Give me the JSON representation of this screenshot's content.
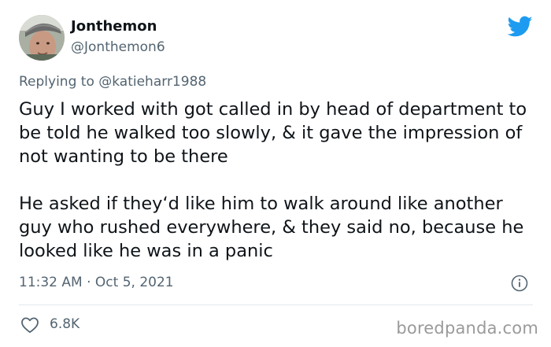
{
  "author": {
    "display_name": "Jonthemon",
    "handle": "@Jonthemon6"
  },
  "reply": {
    "prefix": "Replying to ",
    "mention": "@katieharr1988"
  },
  "tweet": {
    "paragraph_1": "Guy I worked with got called in by head of department to be told he walked too slowly, & it gave the impression of not wanting to be there",
    "paragraph_2": "He asked if they‘d like him to walk around like another guy who rushed everywhere, & they said no, because he looked like he was in a panic"
  },
  "meta": {
    "timestamp": "11:32 AM · Oct 5, 2021"
  },
  "actions": {
    "likes": "6.8K"
  },
  "watermark": "boredpanda.com",
  "icons": {
    "brand": "twitter-bird-icon",
    "info": "info-icon",
    "like": "heart-icon"
  },
  "colors": {
    "twitter_blue": "#1d9bf0",
    "text": "#0f1419",
    "muted": "#536471"
  }
}
